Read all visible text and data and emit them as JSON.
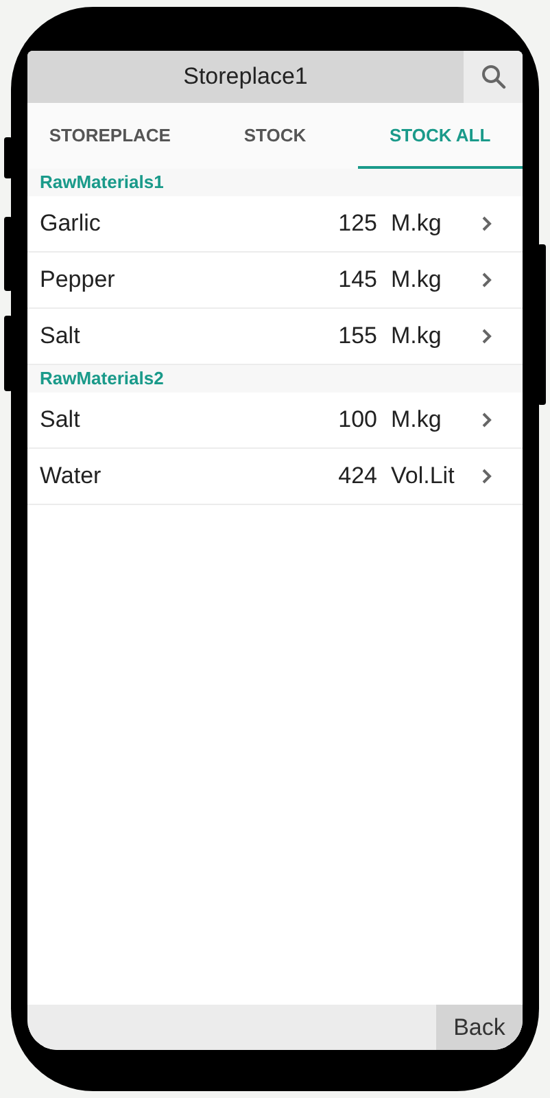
{
  "header": {
    "title": "Storeplace1"
  },
  "tabs": [
    {
      "label": "STOREPLACE",
      "selected": false
    },
    {
      "label": "STOCK",
      "selected": false
    },
    {
      "label": "STOCK ALL",
      "selected": true
    }
  ],
  "groups": [
    {
      "title": "RawMaterials1",
      "items": [
        {
          "name": "Garlic",
          "quantity": "125",
          "unit": "M.kg"
        },
        {
          "name": "Pepper",
          "quantity": "145",
          "unit": "M.kg"
        },
        {
          "name": "Salt",
          "quantity": "155",
          "unit": "M.kg"
        }
      ]
    },
    {
      "title": "RawMaterials2",
      "items": [
        {
          "name": "Salt",
          "quantity": "100",
          "unit": "M.kg"
        },
        {
          "name": "Water",
          "quantity": "424",
          "unit": "Vol.Lit"
        }
      ]
    }
  ],
  "footer": {
    "button": "Back"
  }
}
